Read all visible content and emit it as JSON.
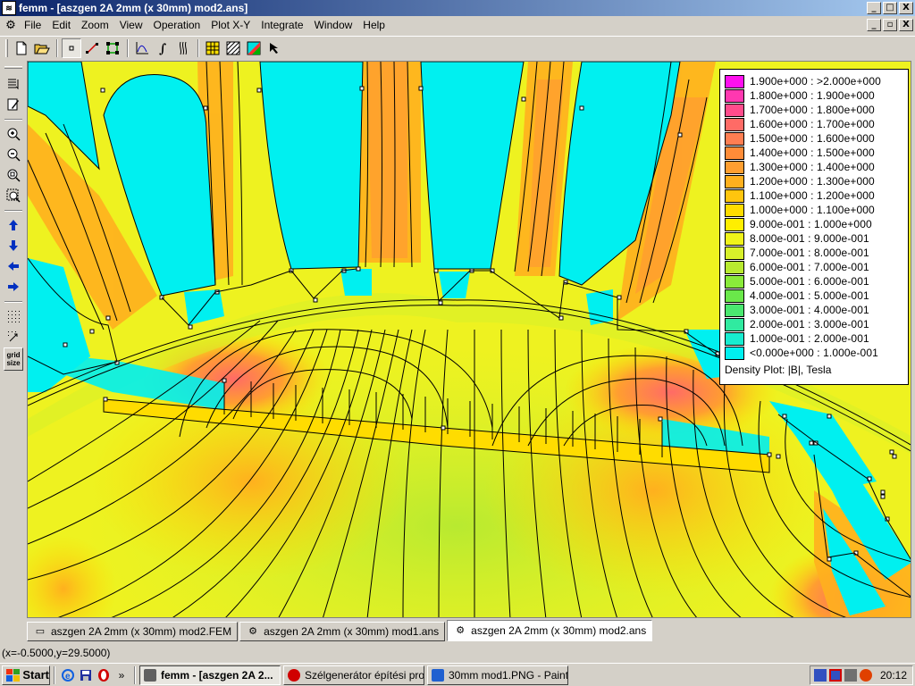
{
  "window": {
    "app_icon": "femm-icon",
    "title": "femm - [aszgen 2A 2mm (x 30mm) mod2.ans]",
    "minimize": "_",
    "maximize": "▫",
    "close": "X"
  },
  "menu": {
    "items": [
      "File",
      "Edit",
      "Zoom",
      "View",
      "Operation",
      "Plot X-Y",
      "Integrate",
      "Window",
      "Help"
    ]
  },
  "toolbar": {
    "buttons": [
      "new-file-icon",
      "open-folder-icon",
      "point-mode-icon",
      "contour-mode-icon",
      "area-mode-icon",
      "xy-plot-icon",
      "integral-icon",
      "contour-plot-icon",
      "mesh-toggle-icon",
      "hatch-toggle-icon",
      "density-plot-icon",
      "select-arrow-icon"
    ]
  },
  "left_toolbar": {
    "buttons": [
      "outputs-icon",
      "edit-properties-icon",
      "zoom-in-icon",
      "zoom-out-icon",
      "zoom-natural-icon",
      "zoom-window-icon",
      "pan-up-icon",
      "pan-down-icon",
      "pan-left-icon",
      "pan-right-icon",
      "show-grid-icon",
      "snap-grid-icon"
    ],
    "grid_size_label": "grid size"
  },
  "legend": {
    "entries": [
      {
        "label": "1.900e+000 : >2.000e+000",
        "color": "#ff10ee"
      },
      {
        "label": "1.800e+000 : 1.900e+000",
        "color": "#ff38b0"
      },
      {
        "label": "1.700e+000 : 1.800e+000",
        "color": "#ff4c8c"
      },
      {
        "label": "1.600e+000 : 1.700e+000",
        "color": "#ff6b66"
      },
      {
        "label": "1.500e+000 : 1.600e+000",
        "color": "#ff7e52"
      },
      {
        "label": "1.400e+000 : 1.500e+000",
        "color": "#ff8c38"
      },
      {
        "label": "1.300e+000 : 1.400e+000",
        "color": "#ff9e30"
      },
      {
        "label": "1.200e+000 : 1.300e+000",
        "color": "#ffb01e"
      },
      {
        "label": "1.100e+000 : 1.200e+000",
        "color": "#ffc50e"
      },
      {
        "label": "1.000e+000 : 1.100e+000",
        "color": "#ffdc00"
      },
      {
        "label": "9.000e-001 : 1.000e+000",
        "color": "#ffee00"
      },
      {
        "label": "8.000e-001 : 9.000e-001",
        "color": "#f0f31a"
      },
      {
        "label": "7.000e-001 : 8.000e-001",
        "color": "#d8f02a"
      },
      {
        "label": "6.000e-001 : 7.000e-001",
        "color": "#b8ea30"
      },
      {
        "label": "5.000e-001 : 6.000e-001",
        "color": "#8aea3a"
      },
      {
        "label": "4.000e-001 : 5.000e-001",
        "color": "#6ae84a"
      },
      {
        "label": "3.000e-001 : 4.000e-001",
        "color": "#4ae870"
      },
      {
        "label": "2.000e-001 : 3.000e-001",
        "color": "#30eaa0"
      },
      {
        "label": "1.000e-001 : 2.000e-001",
        "color": "#18ecd0"
      },
      {
        "label": "<0.000e+000 : 1.000e-001",
        "color": "#00f0f0"
      }
    ],
    "title": "Density Plot: |B|, Tesla"
  },
  "doc_tabs": [
    {
      "label": "aszgen 2A 2mm (x 30mm) mod2.FEM",
      "active": false
    },
    {
      "label": "aszgen 2A 2mm (x 30mm) mod1.ans",
      "active": false
    },
    {
      "label": "aszgen 2A 2mm (x 30mm) mod2.ans",
      "active": true
    }
  ],
  "status": {
    "coordinates": "(x=-0.5000,y=29.5000)"
  },
  "taskbar": {
    "start_label": "Start",
    "quick_launch": [
      "ie-icon",
      "save-disk-icon",
      "opera-icon"
    ],
    "expand": "»",
    "tasks": [
      {
        "label": "femm - [aszgen 2A 2...",
        "active": true,
        "color": "#606060"
      },
      {
        "label": "Szélgenerátor építési pro...",
        "active": false,
        "color": "#d00000"
      },
      {
        "label": "30mm mod1.PNG - Paint",
        "active": false,
        "color": "#2060d0"
      }
    ],
    "tray_icons": [
      "network-icon",
      "network-disconnected-icon",
      "speaker-icon",
      "security-alert-icon"
    ],
    "clock": "20:12"
  },
  "colors": {
    "field_low": "#00f0f0",
    "field_mid": "#e6f230",
    "field_high": "#ff8c38",
    "field_peak": "#ff6b66"
  }
}
